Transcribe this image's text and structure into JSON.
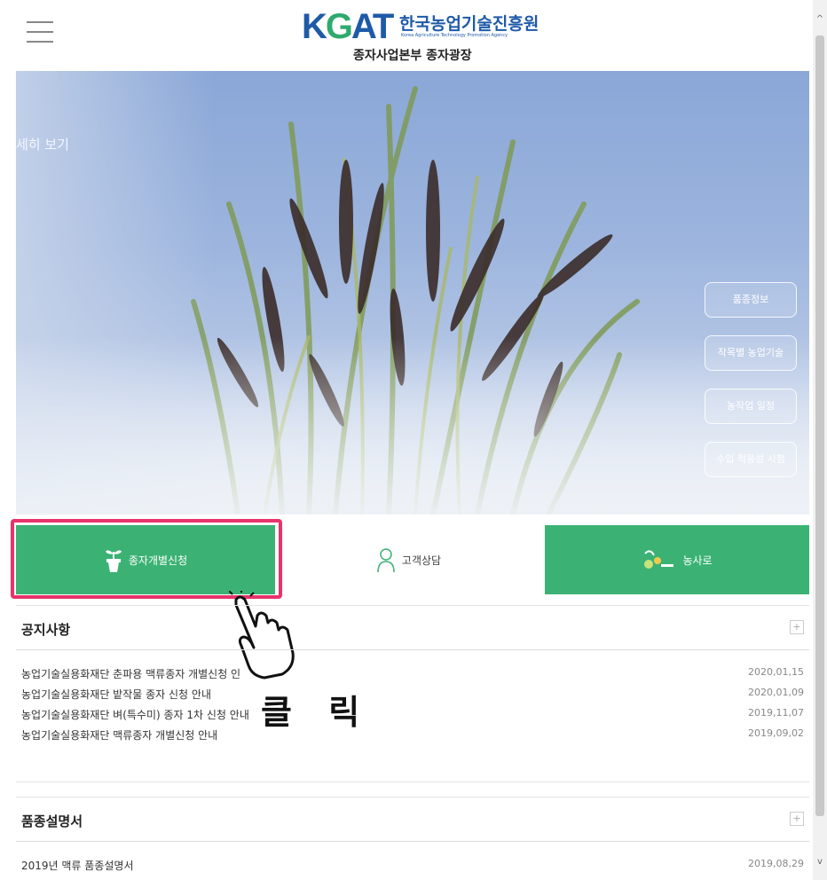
{
  "header": {
    "logo_k": "K",
    "logo_g": "G",
    "logo_at": "AT",
    "org_name": "한국농업기술진흥원",
    "org_name_en": "Korea Agriculture Technology Promotion Agency",
    "sub_title": "종자사업본부 종자광장"
  },
  "hero": {
    "side_text": "세히 보기",
    "buttons": [
      "품종정보",
      "작목별 농업기술",
      "농작업 일정",
      "수입 적응성 시험"
    ]
  },
  "quick_menu": {
    "item1": "종자개별신청",
    "item2": "고객상담",
    "item3": "농사로"
  },
  "annotation": {
    "click_label": "클 릭"
  },
  "notices": {
    "title": "공지사항",
    "more": "+",
    "items": [
      {
        "title": "농업기술실용화재단 춘파용 맥류종자 개별신청 인",
        "date": "2020,01,15"
      },
      {
        "title": "농업기술실용화재단 밭작물 종자 신청 안내",
        "date": "2020,01,09"
      },
      {
        "title": "농업기술실용화재단 벼(특수미) 종자 1차 신청 안내",
        "date": "2019,11,07"
      },
      {
        "title": "농업기술실용화재단 맥류종자 개별신청 안내",
        "date": "2019,09,02"
      }
    ]
  },
  "varieties": {
    "title": "품종설명서",
    "more": "+",
    "items": [
      {
        "title": "2019년 맥류 품종설명서",
        "date": "2019,08,29"
      }
    ]
  },
  "scrollbar": {
    "up": "^",
    "down": "v"
  }
}
